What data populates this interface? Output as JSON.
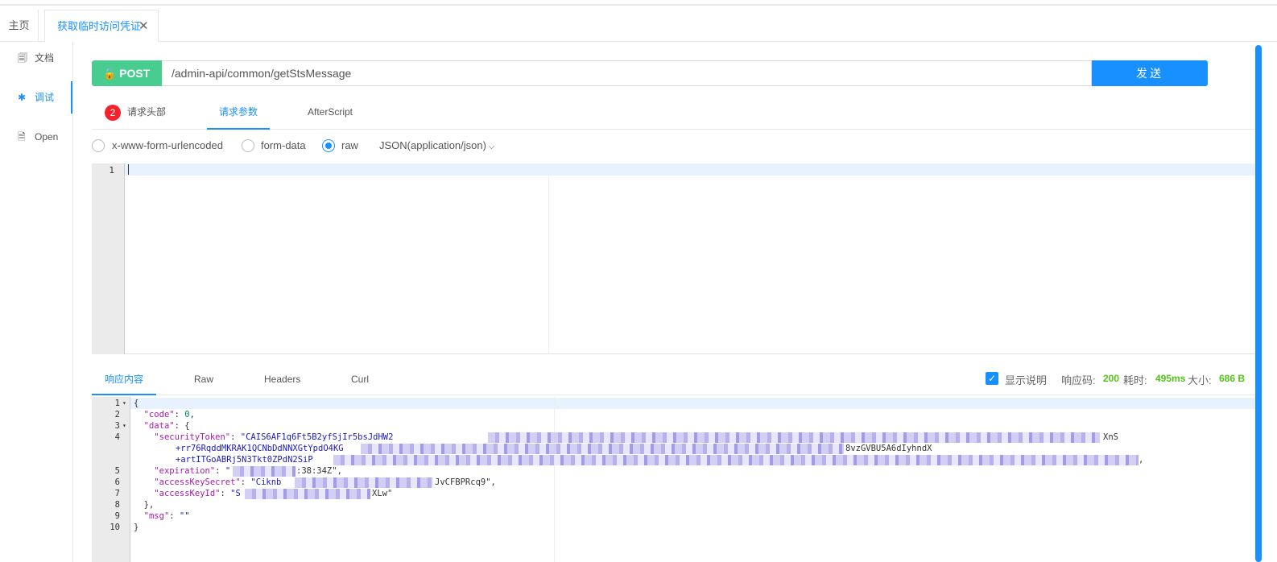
{
  "tabs": {
    "home": "主页",
    "active": "获取临时访问凭证",
    "close": "✕"
  },
  "sidebar": {
    "items": [
      {
        "icon": "🗐",
        "label": "文档"
      },
      {
        "icon": "✱",
        "label": "调试"
      },
      {
        "icon": "🗎",
        "label": "Open"
      }
    ]
  },
  "request": {
    "method": "POST",
    "url": "/admin-api/common/getStsMessage",
    "send_label": "发送"
  },
  "request_tabs": {
    "headers_count": "2",
    "headers": "请求头部",
    "params": "请求参数",
    "afterscript": "AfterScript"
  },
  "body_types": {
    "urlencoded": "x-www-form-urlencoded",
    "formdata": "form-data",
    "raw": "raw",
    "format": "JSON(application/json)",
    "selected": "raw"
  },
  "editor": {
    "line1": "1"
  },
  "response_tabs": {
    "content": "响应内容",
    "raw": "Raw",
    "headers": "Headers",
    "curl": "Curl"
  },
  "response_meta": {
    "show_desc": "显示说明",
    "code_label": "响应码:",
    "code": "200",
    "time_label": "耗时:",
    "time": "495ms",
    "size_label": "大小:",
    "size": "686 B"
  },
  "response_lines": {
    "l1": "{",
    "l2_key": "\"code\"",
    "l2_val": "0",
    "l3_key": "\"data\"",
    "l4_key": "\"securityToken\"",
    "l4_val": "\"CAIS6AF1q6Ft5B2yfSjIr5bsJdHW2",
    "l4_tail": "XnS",
    "l4b_val": "+rr76RqddMKRAK1QCNbDdNNXGtYpdO4KG",
    "l4b_tail": "8vzGVBU5A6dIyhndX",
    "l4c_val": "+artITGoABRj5N3Tkt0ZPdN2SiP",
    "l5_key": "\"expiration\"",
    "l5_val": ":38:34Z\"",
    "l6_key": "\"accessKeySecret\"",
    "l6_val_a": "\"Ciknb",
    "l6_val_b": "JvCFBPRcq9\"",
    "l7_key": "\"accessKeyId\"",
    "l7_val_a": "\"S",
    "l7_val_b": "XLw\"",
    "l8": "},",
    "l9_key": "\"msg\"",
    "l9_val": "\"\"",
    "l10": "}"
  }
}
